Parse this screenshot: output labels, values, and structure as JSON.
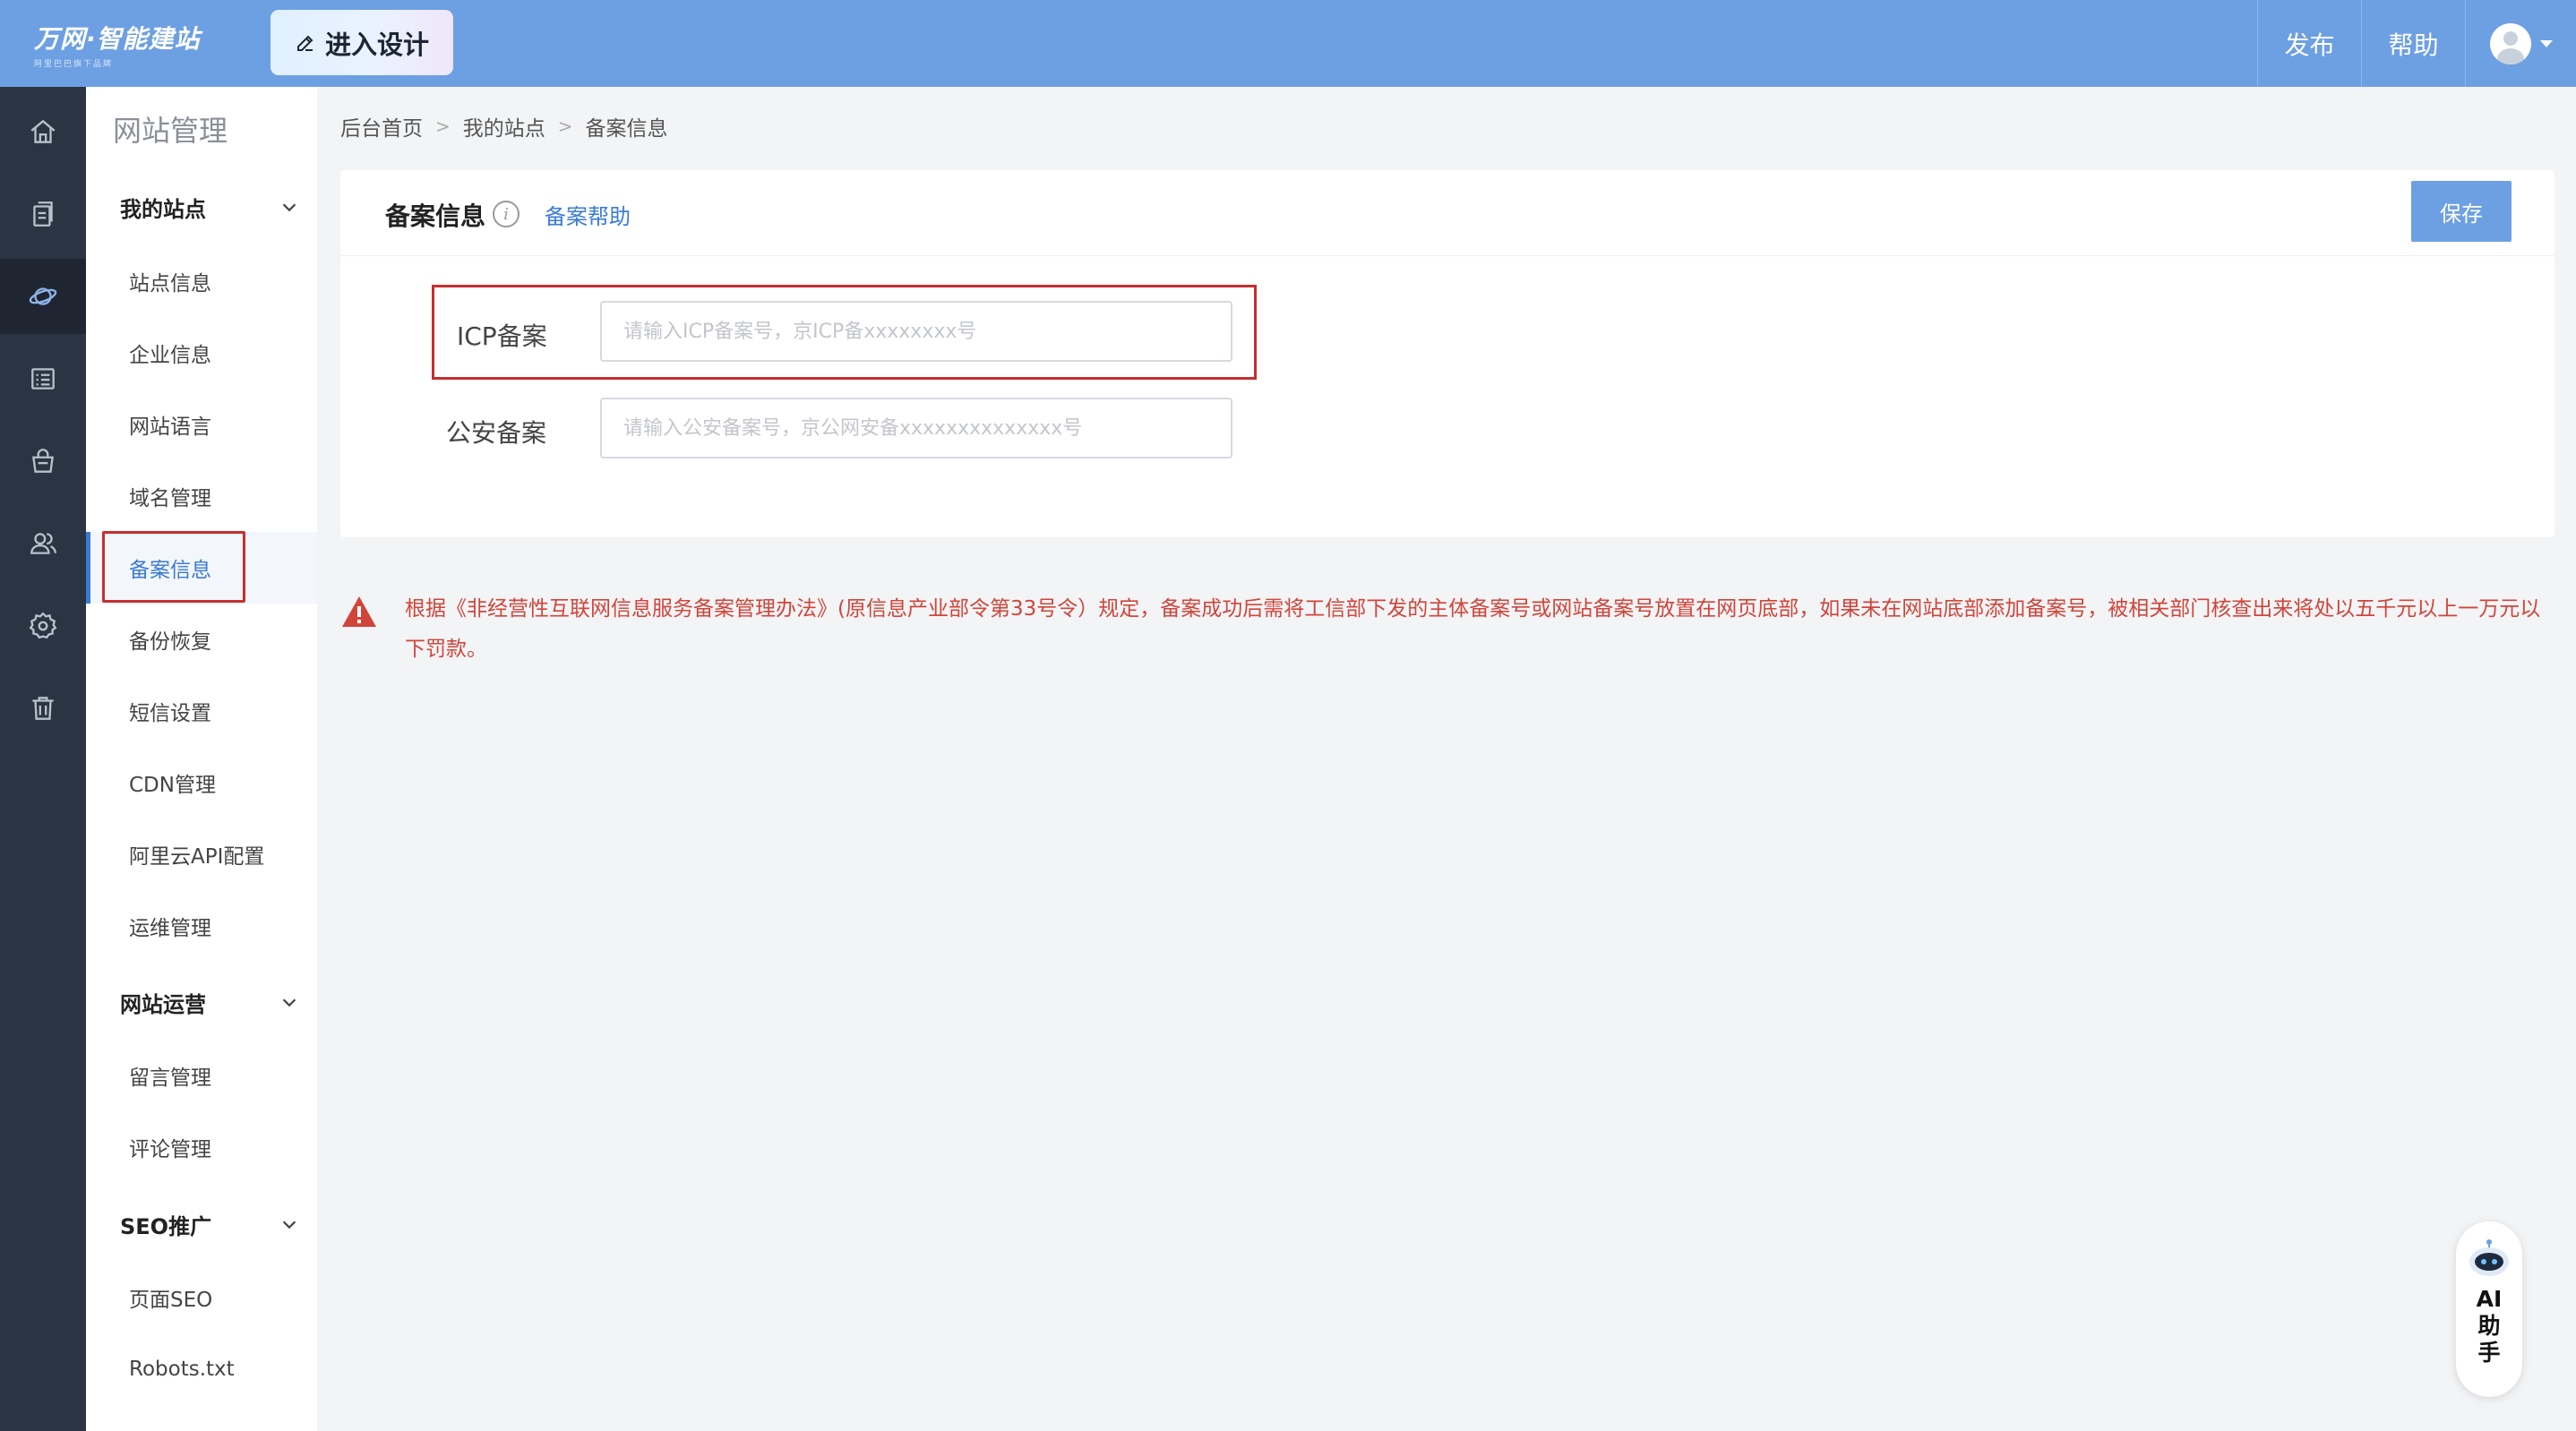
{
  "topbar": {
    "logo_main": "万网·智能建站",
    "logo_sub": "阿里巴巴旗下品牌",
    "design_button": "进入设计",
    "publish": "发布",
    "help": "帮助"
  },
  "rail": {
    "icons": [
      "home-icon",
      "pages-icon",
      "planet-icon",
      "list-icon",
      "shop-bag-icon",
      "users-icon",
      "gear-icon",
      "trash-icon"
    ],
    "active_index": 2
  },
  "sidebar": {
    "title": "网站管理",
    "groups": [
      {
        "label": "我的站点",
        "items": [
          "站点信息",
          "企业信息",
          "网站语言",
          "域名管理",
          "备案信息",
          "备份恢复",
          "短信设置",
          "CDN管理",
          "阿里云API配置",
          "运维管理"
        ]
      },
      {
        "label": "网站运营",
        "items": [
          "留言管理",
          "评论管理"
        ]
      },
      {
        "label": "SEO推广",
        "items": [
          "页面SEO",
          "Robots.txt"
        ]
      }
    ],
    "active_item": "备案信息"
  },
  "breadcrumb": [
    "后台首页",
    "我的站点",
    "备案信息"
  ],
  "card": {
    "title": "备案信息",
    "help_link": "备案帮助",
    "save_button": "保存",
    "icp": {
      "label": "ICP备案",
      "value": "",
      "placeholder": "请输入ICP备案号，京ICP备xxxxxxxx号"
    },
    "police": {
      "label": "公安备案",
      "value": "",
      "placeholder": "请输入公安备案号，京公网安备xxxxxxxxxxxxxx号"
    }
  },
  "notice": {
    "text": "根据《非经营性互联网信息服务备案管理办法》(原信息产业部令第33号令）规定，备案成功后需将工信部下发的主体备案号或网站备案号放置在网页底部，如果未在网站底部添加备案号，被相关部门核查出来将处以五千元以上一万元以下罚款。"
  },
  "ai_assistant": {
    "label_line1": "AI",
    "label_line2": "助",
    "label_line3": "手"
  },
  "colors": {
    "topbar": "#6d9fe3",
    "rail": "#2b3442",
    "accent": "#3a7bd5",
    "warning": "#d0453a",
    "highlight_box": "#c62f2f"
  }
}
